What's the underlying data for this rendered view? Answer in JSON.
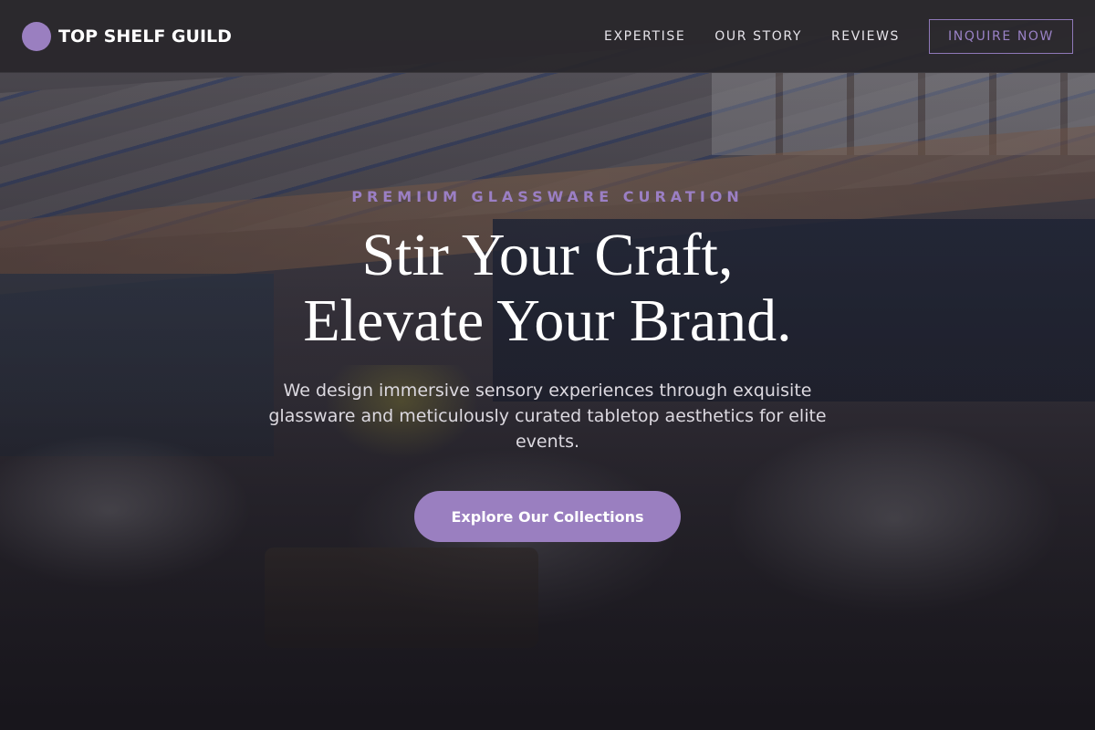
{
  "header": {
    "brand_name": "TOP SHELF GUILD",
    "nav": {
      "expertise": "EXPERTISE",
      "our_story": "OUR STORY",
      "reviews": "REVIEWS",
      "cta": "INQUIRE NOW"
    }
  },
  "hero": {
    "eyebrow": "PREMIUM GLASSWARE CURATION",
    "headline_line1": "Stir Your Craft,",
    "headline_line2": "Elevate Your Brand.",
    "subtext": "We design immersive sensory experiences through exquisite glassware and meticulously curated tabletop aesthetics for elite events.",
    "button_label": "Explore Our Collections"
  },
  "colors": {
    "accent": "#9a7fc0",
    "header_bg": "#28262a",
    "text_light": "#ffffff"
  },
  "icons": {
    "brand_logo": "circle-logo-icon"
  }
}
